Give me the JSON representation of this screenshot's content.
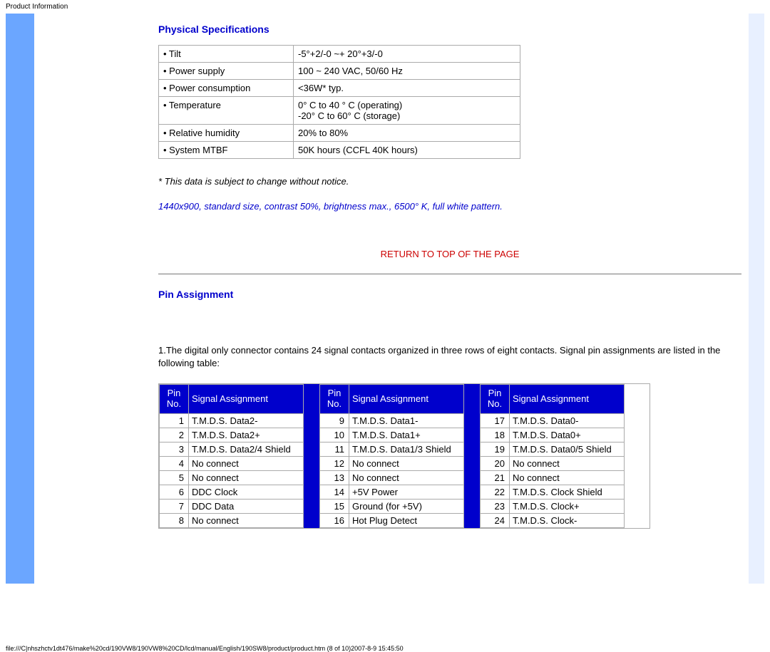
{
  "header": {
    "label": "Product Information"
  },
  "physical": {
    "title": "Physical Specifications",
    "rows": [
      {
        "label": "• Tilt",
        "value": "-5°+2/-0 ~+ 20°+3/-0"
      },
      {
        "label": "• Power supply",
        "value": "100 ~ 240 VAC, 50/60 Hz"
      },
      {
        "label": "• Power consumption",
        "value": "<36W* typ."
      },
      {
        "label": "• Temperature",
        "value": "0° C to 40 ° C (operating)\n-20° C to 60° C (storage)"
      },
      {
        "label": "• Relative humidity",
        "value": "20% to 80%"
      },
      {
        "label": "• System MTBF",
        "value": "50K hours (CCFL 40K hours)"
      }
    ],
    "disclaimer": "* This data is subject to change without notice.",
    "note": "1440x900, standard size, contrast 50%, brightness max., 6500° K, full white pattern."
  },
  "return_link": "RETURN TO TOP OF THE PAGE",
  "pin": {
    "title": "Pin Assignment",
    "paragraph": "1.The digital only connector contains 24 signal contacts organized in three rows of eight contacts. Signal pin assignments are listed in the following table:",
    "header_pin": "Pin No.",
    "header_sig": "Signal Assignment",
    "groups": [
      [
        {
          "no": "1",
          "sig": "T.M.D.S. Data2-"
        },
        {
          "no": "2",
          "sig": "T.M.D.S. Data2+"
        },
        {
          "no": "3",
          "sig": "T.M.D.S. Data2/4 Shield"
        },
        {
          "no": "4",
          "sig": "No connect"
        },
        {
          "no": "5",
          "sig": "No connect"
        },
        {
          "no": "6",
          "sig": "DDC Clock"
        },
        {
          "no": "7",
          "sig": "DDC Data"
        },
        {
          "no": "8",
          "sig": "No connect"
        }
      ],
      [
        {
          "no": "9",
          "sig": "T.M.D.S. Data1-"
        },
        {
          "no": "10",
          "sig": "T.M.D.S. Data1+"
        },
        {
          "no": "11",
          "sig": "T.M.D.S. Data1/3 Shield"
        },
        {
          "no": "12",
          "sig": "No connect"
        },
        {
          "no": "13",
          "sig": "No connect"
        },
        {
          "no": "14",
          "sig": "+5V Power"
        },
        {
          "no": "15",
          "sig": "Ground (for +5V)"
        },
        {
          "no": "16",
          "sig": "Hot Plug Detect"
        }
      ],
      [
        {
          "no": "17",
          "sig": "T.M.D.S. Data0-"
        },
        {
          "no": "18",
          "sig": "T.M.D.S. Data0+"
        },
        {
          "no": "19",
          "sig": "T.M.D.S. Data0/5 Shield"
        },
        {
          "no": "20",
          "sig": "No connect"
        },
        {
          "no": "21",
          "sig": "No connect"
        },
        {
          "no": "22",
          "sig": "T.M.D.S. Clock Shield"
        },
        {
          "no": "23",
          "sig": "T.M.D.S. Clock+"
        },
        {
          "no": "24",
          "sig": "T.M.D.S. Clock-"
        }
      ]
    ]
  },
  "footer": "file:///C|nhszhctv1dt476/make%20cd/190VW8/190VW8%20CD/lcd/manual/English/190SW8/product/product.htm (8 of 10)2007-8-9 15:45:50"
}
